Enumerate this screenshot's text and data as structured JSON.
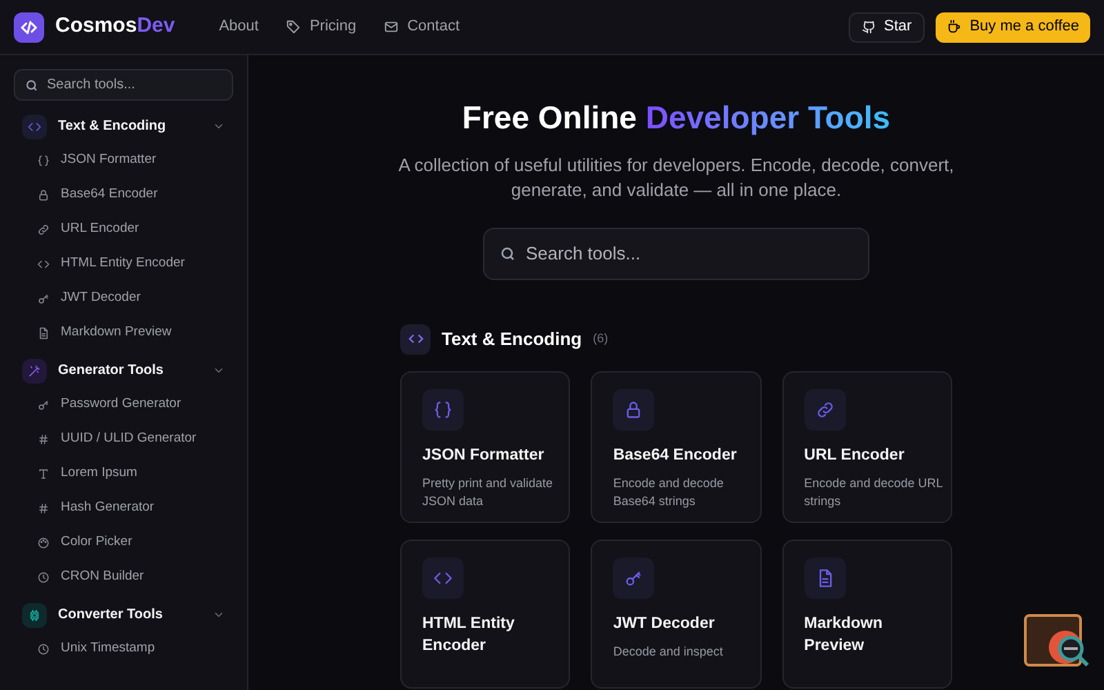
{
  "header": {
    "logo": {
      "name": "Cosmos",
      "accent": "Dev"
    },
    "nav": [
      {
        "label": "About"
      },
      {
        "label": "Pricing"
      },
      {
        "label": "Contact"
      }
    ],
    "star_button": "Star",
    "coffee_button": "Buy me a coffee"
  },
  "sidebar": {
    "search": {
      "placeholder": "Search tools..."
    },
    "groups": [
      {
        "label": "Text & Encoding",
        "expanded": true,
        "items": [
          {
            "label": "JSON Formatter"
          },
          {
            "label": "Base64 Encoder"
          },
          {
            "label": "URL Encoder"
          },
          {
            "label": "HTML Entity Encoder"
          },
          {
            "label": "JWT Decoder"
          },
          {
            "label": "Markdown Preview"
          }
        ]
      },
      {
        "label": "Generator Tools",
        "expanded": true,
        "items": [
          {
            "label": "Password Generator"
          },
          {
            "label": "UUID / ULID Generator"
          },
          {
            "label": "Lorem Ipsum"
          },
          {
            "label": "Hash Generator"
          },
          {
            "label": "Color Picker"
          },
          {
            "label": "CRON Builder"
          }
        ]
      },
      {
        "label": "Converter Tools",
        "expanded": true,
        "items": [
          {
            "label": "Unix Timestamp"
          }
        ]
      }
    ]
  },
  "hero": {
    "title": {
      "plain": "Free Online ",
      "accent": "Developer Tools"
    },
    "subtitle": "A collection of useful utilities for developers. Encode, decode, convert, generate, and validate — all in one place.",
    "search": {
      "placeholder": "Search tools..."
    }
  },
  "section": {
    "title": "Text & Encoding",
    "count": "(6)",
    "cards": [
      {
        "title": "JSON Formatter",
        "description": "Pretty print and validate JSON data"
      },
      {
        "title": "Base64 Encoder",
        "description": "Encode and decode Base64 strings"
      },
      {
        "title": "URL Encoder",
        "description": "Encode and decode URL strings"
      },
      {
        "title": "HTML Entity Encoder"
      },
      {
        "title": "JWT Decoder",
        "description": "Decode and inspect"
      },
      {
        "title": "Markdown Preview"
      }
    ]
  }
}
